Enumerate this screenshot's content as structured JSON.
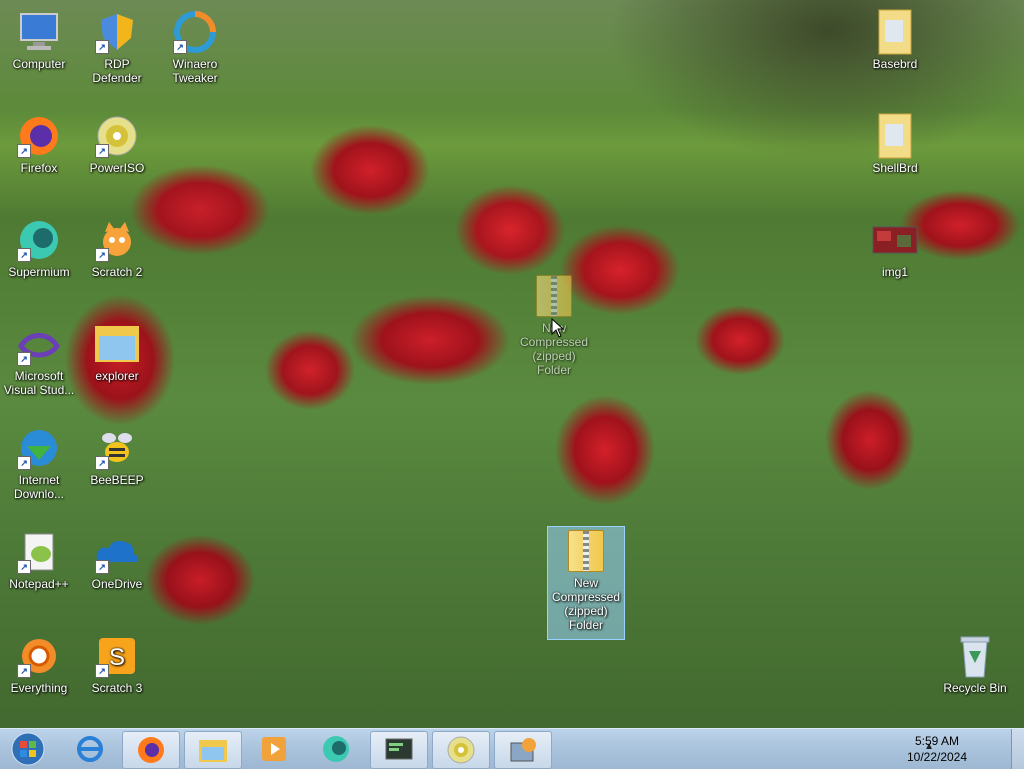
{
  "desktop": {
    "icons": [
      {
        "label": "Computer"
      },
      {
        "label": "RDP Defender"
      },
      {
        "label": "Winaero Tweaker"
      },
      {
        "label": "Firefox"
      },
      {
        "label": "PowerISO"
      },
      {
        "label": "Supermium"
      },
      {
        "label": "Scratch 2"
      },
      {
        "label": "Microsoft Visual Stud..."
      },
      {
        "label": "explorer"
      },
      {
        "label": "Internet Downlo..."
      },
      {
        "label": "BeeBEEP"
      },
      {
        "label": "Notepad++"
      },
      {
        "label": "OneDrive"
      },
      {
        "label": "Everything"
      },
      {
        "label": "Scratch 3"
      },
      {
        "label": "Basebrd"
      },
      {
        "label": "ShellBrd"
      },
      {
        "label": "img1"
      },
      {
        "label": "Recycle Bin"
      },
      {
        "label": "New Compressed (zipped) Folder"
      },
      {
        "label": "New Compressed (zipped) Folder"
      }
    ]
  },
  "taskbar": {
    "clock_time": "5:59 AM",
    "clock_date": "10/22/2024",
    "tray_arrow": "▲"
  },
  "colors": {
    "taskbar": "#a9c3dc",
    "selection": "#99d1ff"
  }
}
